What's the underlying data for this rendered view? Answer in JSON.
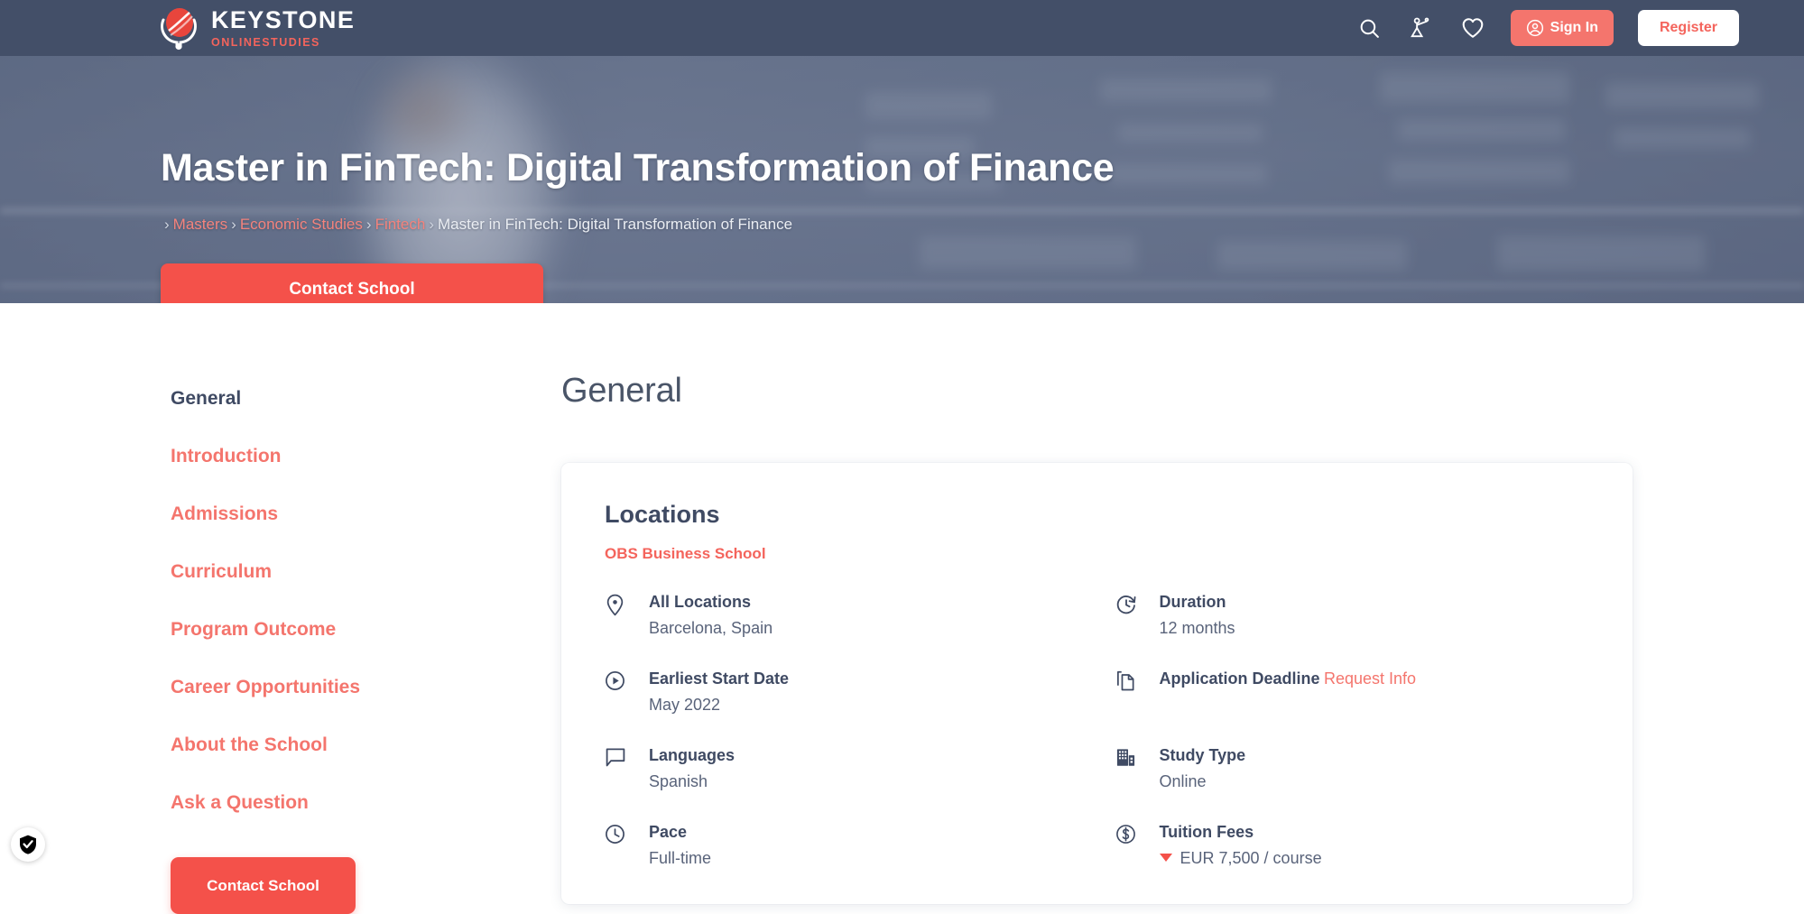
{
  "brand": {
    "name": "KEYSTONE",
    "tagline": "ONLINESTUDIES",
    "accent": "#f4645c",
    "header_bg": "#434f68"
  },
  "header": {
    "icons": [
      {
        "name": "search-icon",
        "label": "Search"
      },
      {
        "name": "compare-icon",
        "label": "Compare"
      },
      {
        "name": "heart-icon",
        "label": "Favourites"
      }
    ],
    "sign_in_label": "Sign In",
    "register_label": "Register"
  },
  "hero": {
    "title": "Master in FinTech: Digital Transformation of Finance",
    "breadcrumb": [
      {
        "label": "Masters",
        "link": true
      },
      {
        "label": "Economic Studies",
        "link": true
      },
      {
        "label": "Fintech",
        "link": true
      },
      {
        "label": "Master in FinTech: Digital Transformation of Finance",
        "link": false
      }
    ],
    "cta_label": "Contact School"
  },
  "sidebar": {
    "items": [
      {
        "label": "General",
        "active": true
      },
      {
        "label": "Introduction",
        "active": false
      },
      {
        "label": "Admissions",
        "active": false
      },
      {
        "label": "Curriculum",
        "active": false
      },
      {
        "label": "Program Outcome",
        "active": false
      },
      {
        "label": "Career Opportunities",
        "active": false
      },
      {
        "label": "About the School",
        "active": false
      },
      {
        "label": "Ask a Question",
        "active": false
      }
    ],
    "cta_label": "Contact School"
  },
  "main": {
    "section_title": "General",
    "card": {
      "title": "Locations",
      "school": "OBS Business School",
      "items": [
        {
          "icon": "map-pin-icon",
          "label": "All Locations",
          "value": "Barcelona, Spain",
          "is_link": false
        },
        {
          "icon": "history-icon",
          "label": "Duration",
          "value": "12 months",
          "is_link": false
        },
        {
          "icon": "play-circle-icon",
          "label": "Earliest Start Date",
          "value": "May 2022",
          "is_link": false
        },
        {
          "icon": "documents-icon",
          "label": "Application Deadline",
          "value": "Request Info",
          "is_link": true
        },
        {
          "icon": "chat-icon",
          "label": "Languages",
          "value": "Spanish",
          "is_link": false
        },
        {
          "icon": "building-icon",
          "label": "Study Type",
          "value": "Online",
          "is_link": false
        },
        {
          "icon": "clock-icon",
          "label": "Pace",
          "value": "Full-time",
          "is_link": false
        },
        {
          "icon": "dollar-circle-icon",
          "label": "Tuition Fees",
          "value": "EUR 7,500 / course",
          "is_link": false,
          "is_fee": true
        }
      ]
    }
  },
  "privacy_badge": {
    "name": "shield-check-icon"
  }
}
